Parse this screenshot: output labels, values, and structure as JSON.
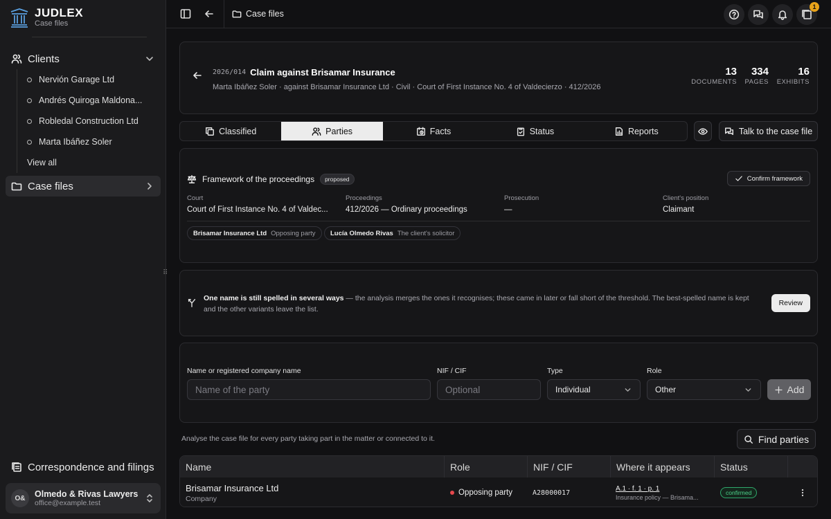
{
  "sidebar": {
    "brand": {
      "title": "JUDLEX",
      "subtitle": "Case files"
    },
    "clients_label": "Clients",
    "clients": [
      "Nervión Garage Ltd",
      "Andrés Quiroga Maldona...",
      "Robledal Construction Ltd",
      "Marta Ibáñez Soler"
    ],
    "view_all": "View all",
    "case_files_label": "Case files",
    "correspondence_label": "Correspondence and filings",
    "account": {
      "initials": "O&",
      "name": "Olmedo & Rivas Lawyers",
      "email": "office@example.test"
    }
  },
  "topbar": {
    "breadcrumb": "Case files",
    "notification_count": "1"
  },
  "case": {
    "code": "2026/014",
    "title": "Claim against Brisamar Insurance",
    "meta": "Marta Ibáñez Soler · against Brisamar Insurance Ltd · Civil · Court of First Instance No. 4 of Valdecierzo · 412/2026",
    "stats": [
      {
        "value": "13",
        "label": "DOCUMENTS"
      },
      {
        "value": "334",
        "label": "PAGES"
      },
      {
        "value": "16",
        "label": "EXHIBITS"
      }
    ]
  },
  "tabs": [
    "Classified",
    "Parties",
    "Facts",
    "Status",
    "Reports"
  ],
  "active_tab": "Parties",
  "talk_button": "Talk to the case file",
  "framework": {
    "title": "Framework of the proceedings",
    "badge": "proposed",
    "confirm_label": "Confirm framework",
    "fields": [
      {
        "label": "Court",
        "value": "Court of First Instance No. 4 of Valdec..."
      },
      {
        "label": "Proceedings",
        "value": "412/2026 — Ordinary proceedings"
      },
      {
        "label": "Prosecution",
        "value": "—"
      },
      {
        "label": "Client's position",
        "value": "Claimant"
      }
    ],
    "chips": [
      {
        "name": "Brisamar Insurance Ltd",
        "role": "Opposing party"
      },
      {
        "name": "Lucía Olmedo Rivas",
        "role": "The client's solicitor"
      }
    ]
  },
  "alert": {
    "bold": "One name is still spelled in several ways",
    "text": " — the analysis merges the ones it recognises; these came in later or fall short of the threshold. The best-spelled name is kept and the other variants leave the list.",
    "button": "Review"
  },
  "form": {
    "name_label": "Name or registered company name",
    "name_placeholder": "Name of the party",
    "nif_label": "NIF / CIF",
    "nif_placeholder": "Optional",
    "type_label": "Type",
    "type_value": "Individual",
    "role_label": "Role",
    "role_value": "Other",
    "add_label": "Add"
  },
  "hint": "Analyse the case file for every party taking part in the matter or connected to it.",
  "find_button": "Find parties",
  "table": {
    "headers": [
      "Name",
      "Role",
      "NIF / CIF",
      "Where it appears",
      "Status"
    ],
    "rows": [
      {
        "name": "Brisamar Insurance Ltd",
        "type": "Company",
        "role": "Opposing party",
        "nif": "A28000017",
        "where_ref": "A.1 · f. 1 · p. 1",
        "where_doc": "Insurance policy — Brisama...",
        "status": "confirmed"
      }
    ]
  }
}
